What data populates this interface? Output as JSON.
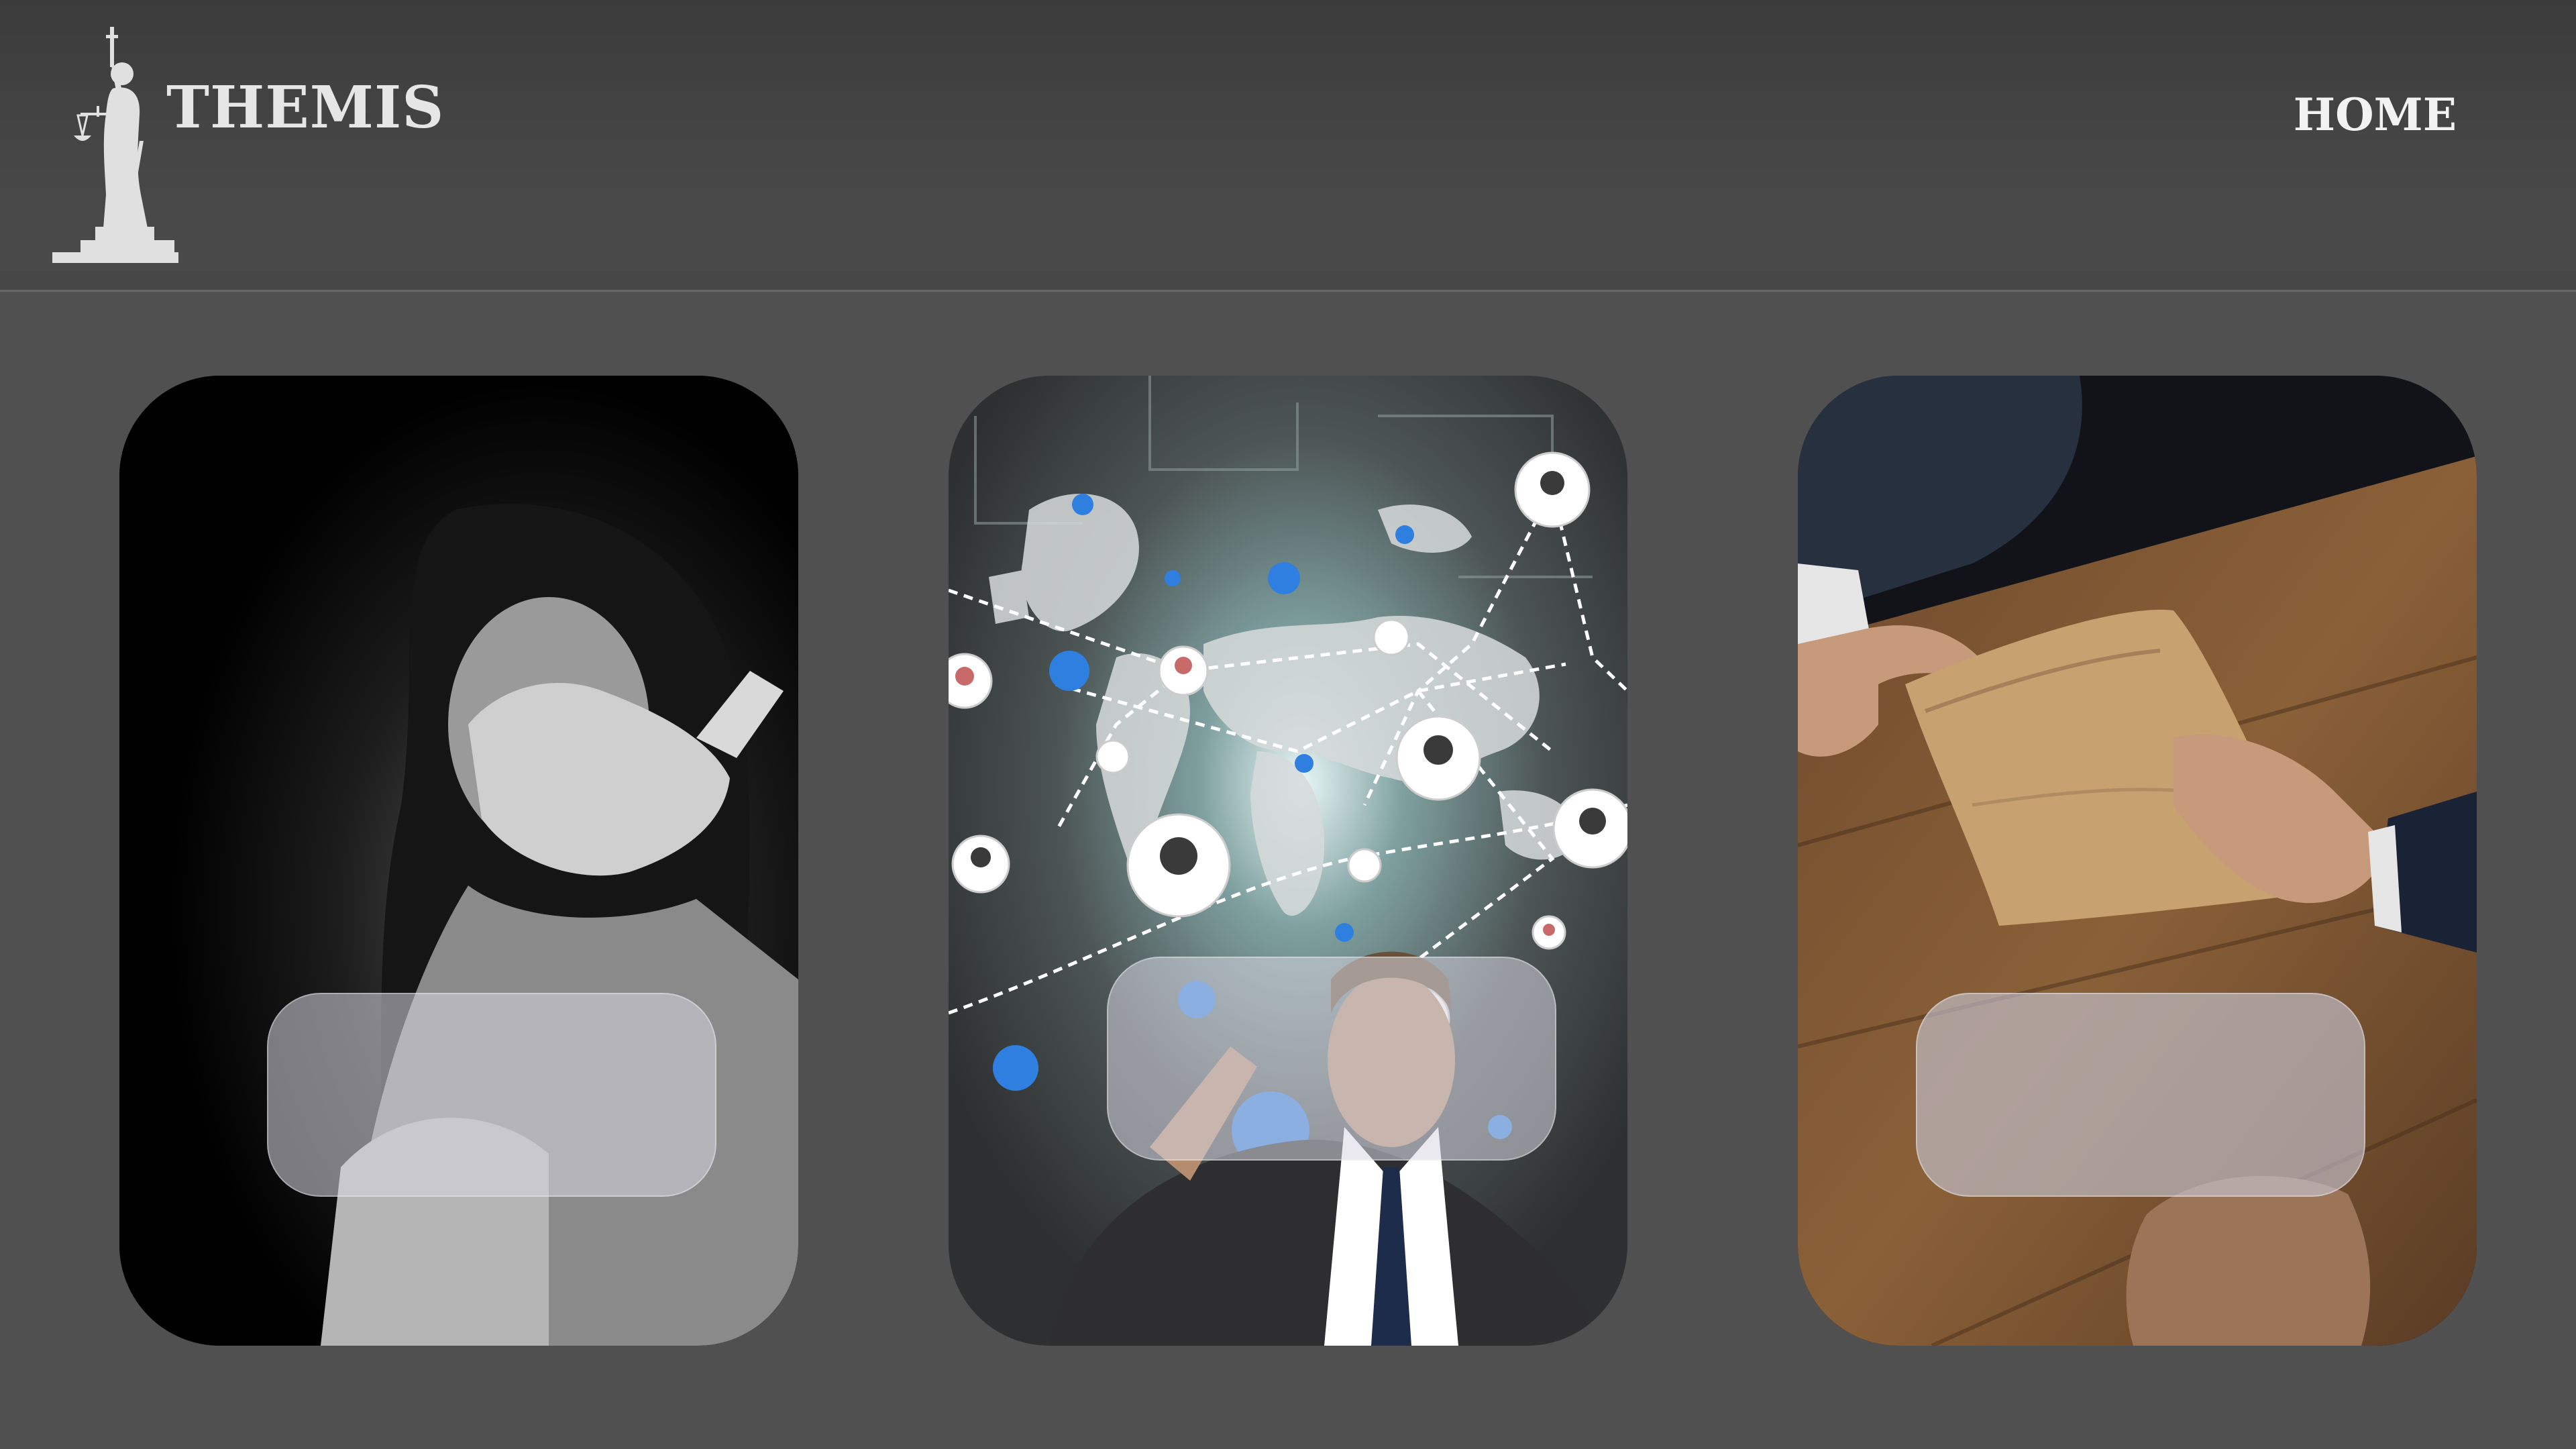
{
  "header": {
    "brand": "THEMIS",
    "logo_icon": "lady-justice-statue-icon",
    "nav": {
      "home_label": "HOME"
    }
  },
  "cards": [
    {
      "image": "distressed-woman-photo",
      "label": ""
    },
    {
      "image": "global-network-photo",
      "label": ""
    },
    {
      "image": "envelope-bribe-photo",
      "label": ""
    }
  ],
  "colors": {
    "page_background": "#505050",
    "header_background": "#444444",
    "brand_text": "#e6e6e6",
    "nav_text": "#f2f2f2"
  }
}
